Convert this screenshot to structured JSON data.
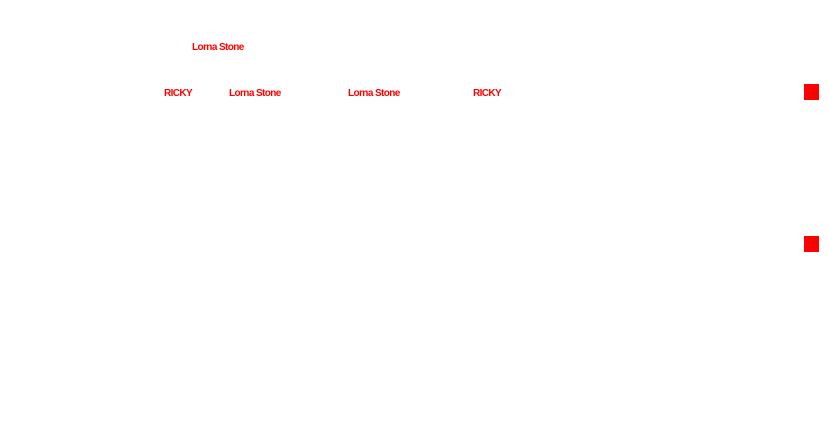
{
  "header": {
    "name": "Lorna Stone"
  },
  "row": {
    "items": [
      {
        "label": "RICKY"
      },
      {
        "label": "Lorna Stone"
      },
      {
        "label": "Lorna Stone"
      },
      {
        "label": "RICKY"
      }
    ]
  },
  "colors": {
    "accent": "#ff0000",
    "background": "#ffffff"
  },
  "markers": [
    {
      "icon": "red-square-marker"
    },
    {
      "icon": "red-square-marker"
    }
  ]
}
